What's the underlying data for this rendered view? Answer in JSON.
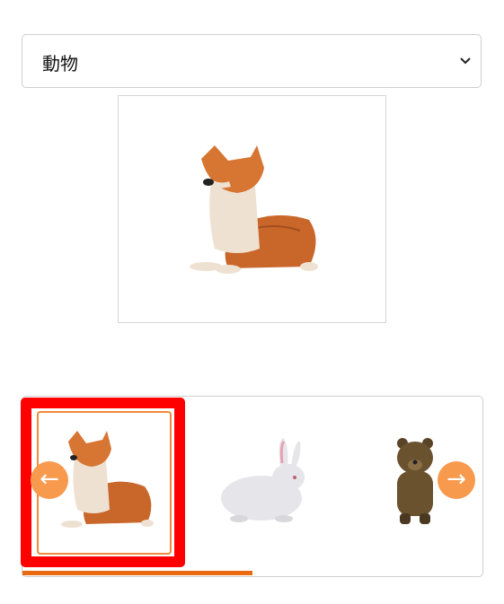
{
  "category_select": {
    "selected_value": "動物",
    "chevron_icon": "chevron-down-icon"
  },
  "preview": {
    "image": "shiba-dog-embroidery"
  },
  "carousel": {
    "items": [
      {
        "image": "shiba-dog-embroidery",
        "selected": true
      },
      {
        "image": "rabbit-embroidery",
        "selected": false
      },
      {
        "image": "bear-embroidery",
        "selected": false
      }
    ],
    "prev_icon": "arrow-left-icon",
    "next_icon": "arrow-right-icon",
    "progress": 0.5,
    "colors": {
      "accent": "#f89a4e",
      "progress": "#ea6a12",
      "highlight": "#ff0000"
    }
  }
}
